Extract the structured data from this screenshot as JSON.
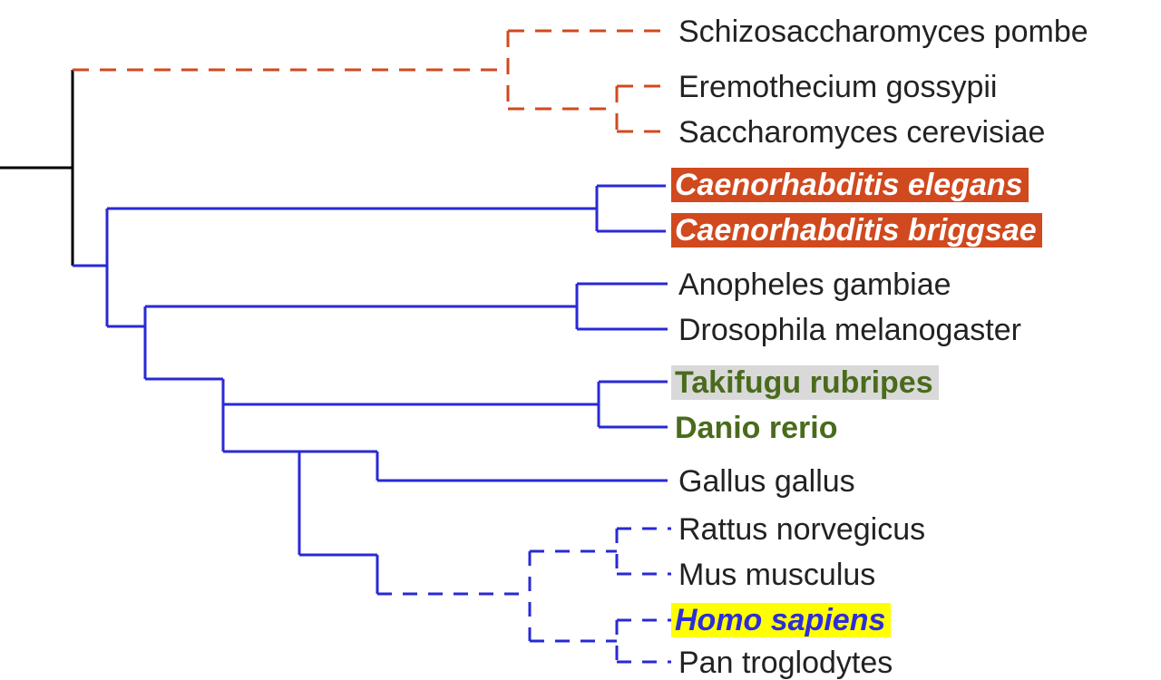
{
  "chart_data": {
    "type": "tree",
    "title": "",
    "root_split_y": 185,
    "clades": [
      {
        "name": "fungi",
        "line_color": "#d1491e",
        "line_style": "dashed",
        "stem_x": 80,
        "stem_y": 77,
        "split_x": 560,
        "children": [
          {
            "leaf": "Schizosaccharomyces pombe",
            "y": 34,
            "tip_x": 730,
            "style": "plain"
          },
          {
            "name": "asco",
            "split_x": 680,
            "y_range": [
              95,
              145
            ],
            "children": [
              {
                "leaf": "Eremothecium gossypii",
                "y": 95,
                "tip_x": 740,
                "style": "plain"
              },
              {
                "leaf": "Saccharomyces cerevisiae",
                "y": 145,
                "tip_x": 740,
                "style": "plain"
              }
            ]
          }
        ]
      },
      {
        "name": "animals",
        "line_color": "#2929d6",
        "line_style": "solid",
        "stem_x": 80,
        "stem_y": 293,
        "split_x": 118,
        "children": [
          {
            "name": "nematodes",
            "split_x": 658,
            "y_range": [
              205,
              255
            ],
            "children": [
              {
                "leaf": "Caenorhabditis elegans",
                "y": 205,
                "tip_x": 734,
                "style": "orangebg"
              },
              {
                "leaf": "Caenorhabditis briggsae",
                "y": 255,
                "tip_x": 734,
                "style": "orangebg"
              }
            ]
          },
          {
            "name": "bilaterian_rest",
            "split_x": 160,
            "y_range": [
              230,
              360
            ],
            "children": [
              {
                "name": "insects",
                "split_x": 636,
                "y_range": [
                  313,
                  363
                ],
                "stem_x": 246,
                "children": [
                  {
                    "leaf": "Anopheles gambiae",
                    "y": 313,
                    "tip_x": 736,
                    "style": "plain"
                  },
                  {
                    "leaf": "Drosophila melanogaster",
                    "y": 363,
                    "tip_x": 736,
                    "style": "plain"
                  }
                ]
              },
              {
                "name": "vertebrates",
                "split_x": 330,
                "stem_x": 246,
                "children": [
                  {
                    "name": "fish",
                    "split_x": 660,
                    "y_range": [
                      421,
                      471
                    ],
                    "children": [
                      {
                        "leaf": "Takifugu rubripes",
                        "y": 421,
                        "tip_x": 736,
                        "style": "greytxt greybg"
                      },
                      {
                        "leaf": "Danio rerio",
                        "y": 471,
                        "tip_x": 736,
                        "style": "greytxt"
                      }
                    ]
                  },
                  {
                    "name": "tetrapods",
                    "split_x": 416,
                    "children": [
                      {
                        "leaf": "Gallus gallus",
                        "y": 530,
                        "tip_x": 736,
                        "style": "plain"
                      },
                      {
                        "name": "mammals",
                        "line_style": "dashed",
                        "split_x": 584,
                        "children": [
                          {
                            "name": "rodents",
                            "split_x": 680,
                            "y_range": [
                              583,
                              633
                            ],
                            "children": [
                              {
                                "leaf": "Rattus norvegicus",
                                "y": 583,
                                "tip_x": 740,
                                "style": "plain"
                              },
                              {
                                "leaf": "Mus musculus",
                                "y": 633,
                                "tip_x": 740,
                                "style": "plain"
                              }
                            ]
                          },
                          {
                            "name": "hominids",
                            "split_x": 680,
                            "y_range": [
                              684,
                              730
                            ],
                            "children": [
                              {
                                "leaf": "Homo sapiens",
                                "y": 684,
                                "tip_x": 740,
                                "style": "yellowbg"
                              },
                              {
                                "leaf": "Pan troglodytes",
                                "y": 730,
                                "tip_x": 740,
                                "style": "plain"
                              }
                            ]
                          }
                        ]
                      }
                    ]
                  }
                ]
              }
            ]
          }
        ]
      }
    ]
  },
  "labels": {
    "sp": "Schizosaccharomyces pombe",
    "eg": "Eremothecium gossypii",
    "sc": "Saccharomyces cerevisiae",
    "ce": "Caenorhabditis elegans",
    "cb": "Caenorhabditis briggsae",
    "ag": "Anopheles gambiae",
    "dm": "Drosophila melanogaster",
    "tr": "Takifugu rubripes",
    "dr": "Danio rerio",
    "gg": "Gallus gallus",
    "rn": "Rattus norvegicus",
    "mm": "Mus musculus",
    "hs": "Homo sapiens",
    "pt": "Pan troglodytes"
  }
}
